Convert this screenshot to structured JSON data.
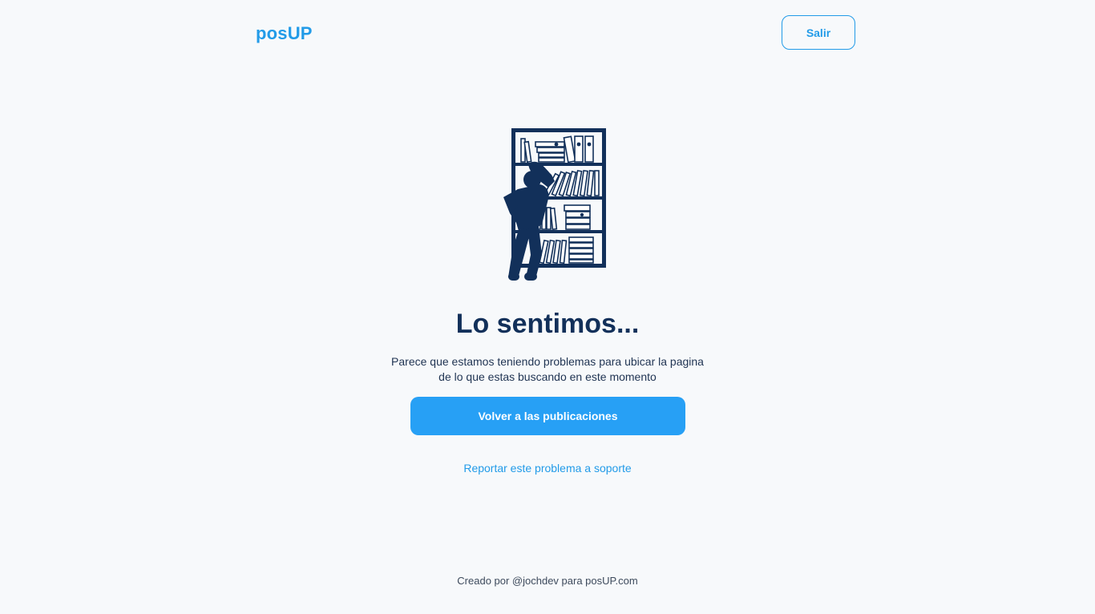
{
  "header": {
    "logo": "posUP",
    "exit_label": "Salir"
  },
  "illustration": {
    "icon": "person-searching-bookshelf-icon",
    "color": "#12305a"
  },
  "main": {
    "title": "Lo sentimos...",
    "message_line1": "Parece que estamos teniendo problemas para ubicar la pagina",
    "message_line2": "de lo que estas buscando en este momento",
    "back_button_label": "Volver a las publicaciones",
    "report_link_label": "Reportar este problema a soporte"
  },
  "footer": {
    "credit": "Creado por @jochdev para posUP.com"
  },
  "colors": {
    "accent": "#229be8",
    "button": "#27a0f5",
    "heading": "#12305a",
    "background": "#f7f9fb"
  }
}
